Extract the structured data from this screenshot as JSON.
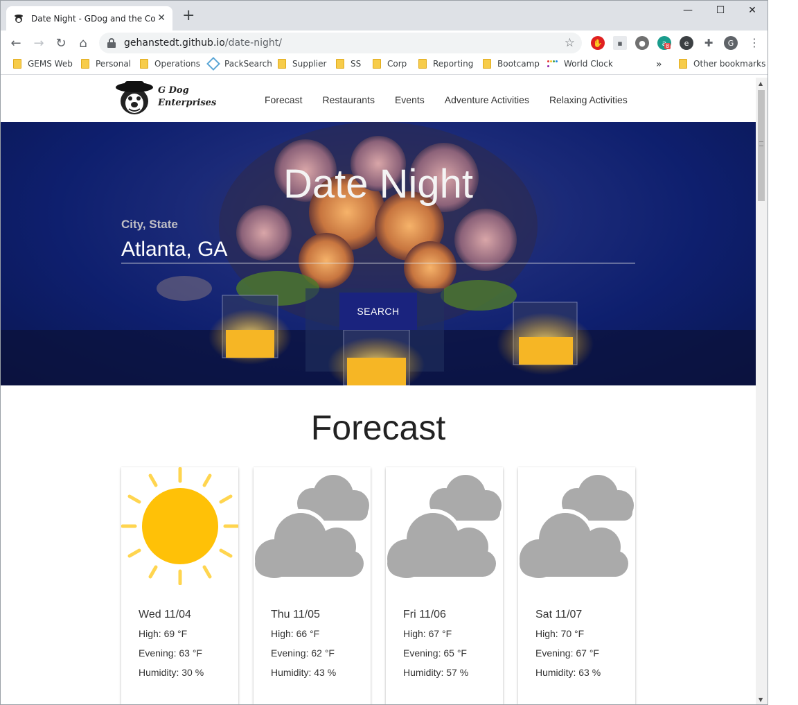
{
  "browser": {
    "tab_title": "Date Night - GDog and the Codin",
    "url_host": "gehanstedt.github.io",
    "url_path": "/date-night/",
    "profile_initial": "G",
    "ext_badge": "8",
    "bookmarks": [
      "GEMS Web",
      "Personal",
      "Operations",
      "PackSearch",
      "Supplier",
      "SS",
      "Corp",
      "Reporting",
      "Bootcamp",
      "World Clock"
    ],
    "other_bookmarks": "Other bookmarks",
    "overflow": "»"
  },
  "site": {
    "logo_line1": "G Dog",
    "logo_line2": "Enterprises",
    "nav": [
      "Forecast",
      "Restaurants",
      "Events",
      "Adventure Activities",
      "Relaxing Activities"
    ]
  },
  "hero": {
    "title": "Date Night",
    "label": "City, State",
    "input_value": "Atlanta, GA",
    "button": "SEARCH"
  },
  "forecast": {
    "title": "Forecast",
    "days": [
      {
        "date": "Wed 11/04",
        "high": "High: 69 °F",
        "evening": "Evening: 63 °F",
        "humidity": "Humidity: 30 %",
        "icon": "sun-icon"
      },
      {
        "date": "Thu 11/05",
        "high": "High: 66 °F",
        "evening": "Evening: 62 °F",
        "humidity": "Humidity: 43 %",
        "icon": "cloud-icon"
      },
      {
        "date": "Fri 11/06",
        "high": "High: 67 °F",
        "evening": "Evening: 65 °F",
        "humidity": "Humidity: 57 %",
        "icon": "cloud-icon"
      },
      {
        "date": "Sat 11/07",
        "high": "High: 70 °F",
        "evening": "Evening: 67 °F",
        "humidity": "Humidity: 63 %",
        "icon": "cloud-icon"
      }
    ]
  },
  "colors": {
    "nav_blue": "#1a237e",
    "sun": "#ffc107",
    "sun_rays": "#ffd54f",
    "cloud": "#aaaaaa"
  }
}
